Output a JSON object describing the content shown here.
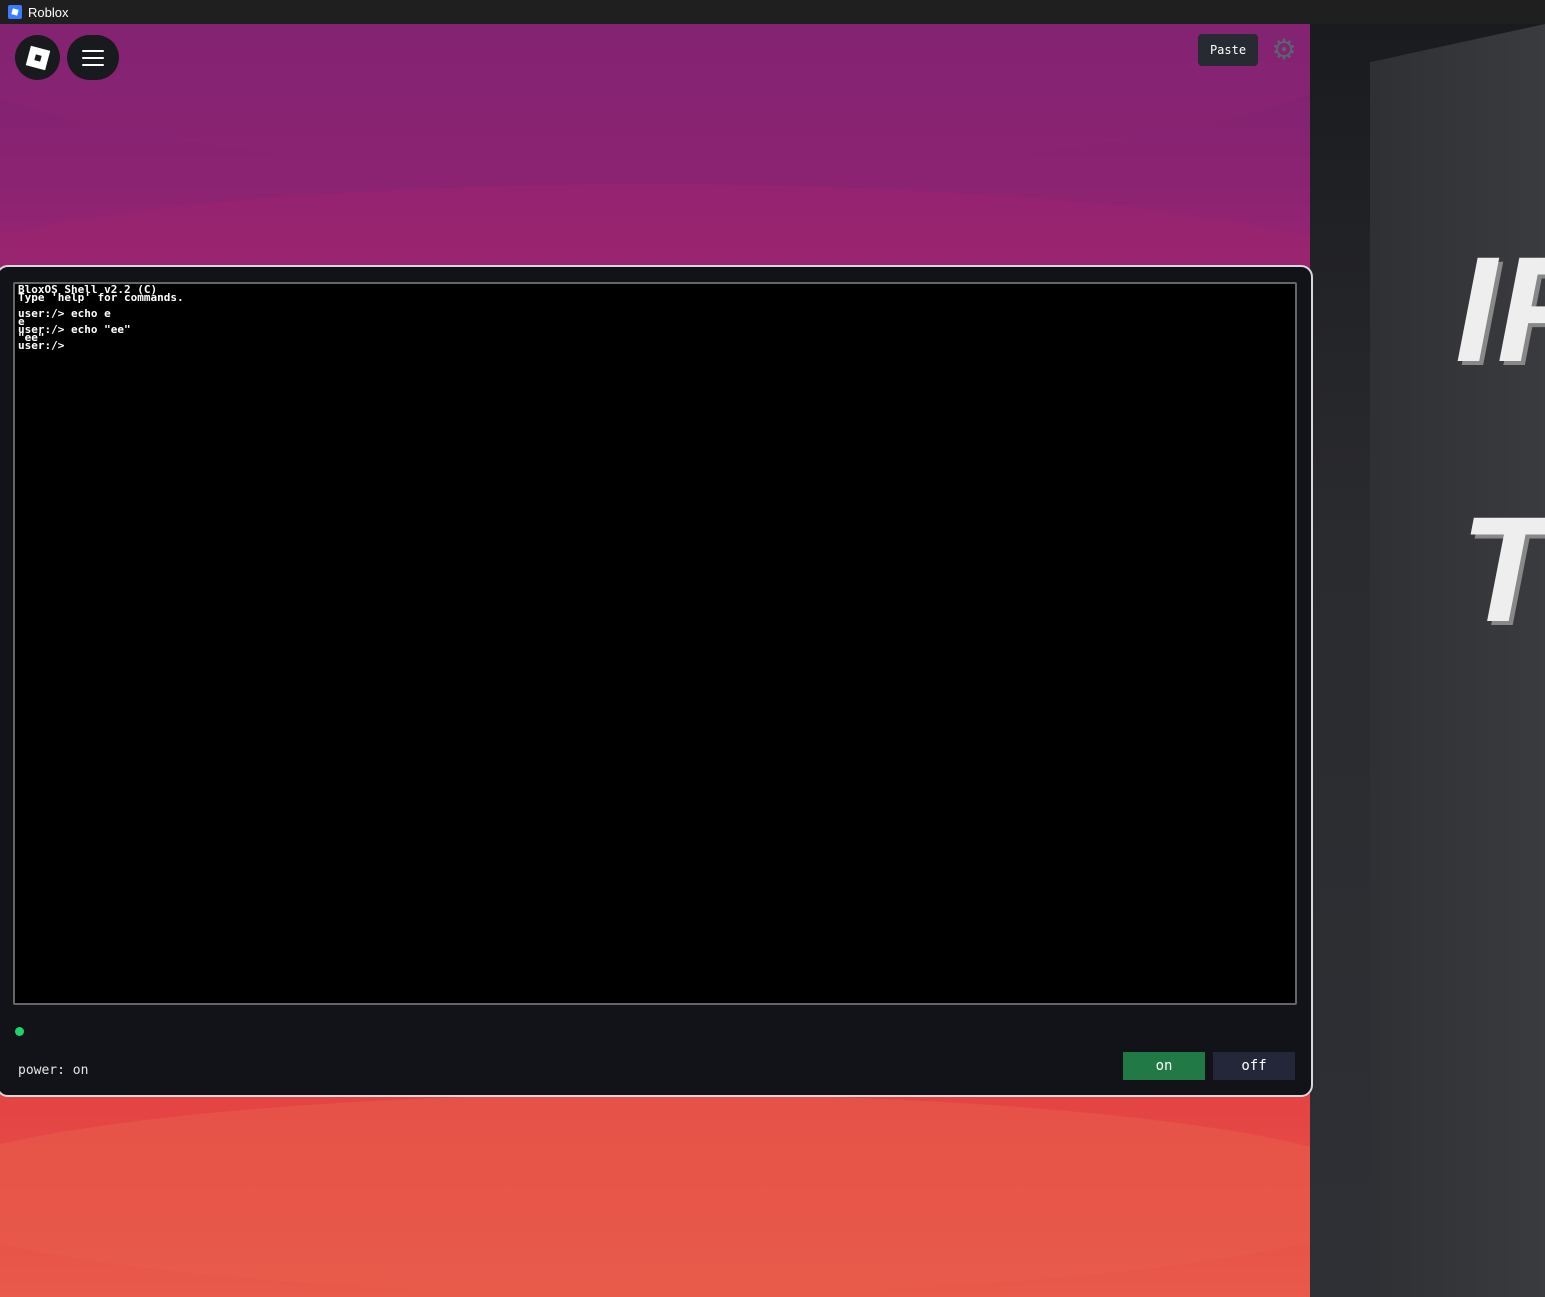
{
  "window": {
    "title": "Roblox"
  },
  "toolbar": {
    "paste_label": "Paste"
  },
  "terminal": {
    "lines": [
      "BloxOS Shell v2.2 (C)",
      "Type 'help' for commands.",
      "",
      "user:/> echo e",
      "e",
      "user:/> echo \"ee\"",
      "\"ee\"",
      "user:/>"
    ]
  },
  "status": {
    "power_text": "power: on",
    "indicator_color": "#1fd36a"
  },
  "controls": {
    "on_label": "on",
    "off_label": "off"
  },
  "scene": {
    "sign_line1": "IF",
    "sign_line2": "TH"
  }
}
